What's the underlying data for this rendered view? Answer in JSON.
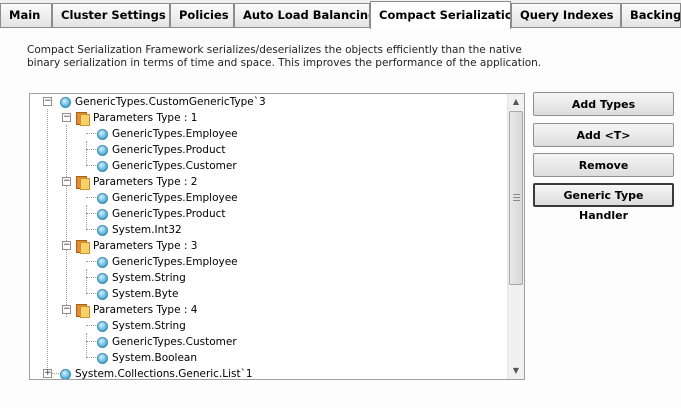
{
  "tabs": [
    {
      "label": "Main"
    },
    {
      "label": "Cluster Settings"
    },
    {
      "label": "Policies"
    },
    {
      "label": "Auto Load Balancing"
    },
    {
      "label": "Compact Serialization",
      "active": true
    },
    {
      "label": "Query Indexes"
    },
    {
      "label": "Backing"
    }
  ],
  "description": {
    "line1": "Compact Serialization Framework serializes/deserializes the objects efficiently than the native",
    "line2": "binary serialization in terms of time and space. This improves the performance of the application."
  },
  "tree": {
    "root1": "GenericTypes.CustomGenericType`3",
    "groups": [
      {
        "label": "Parameters Type : 1",
        "items": [
          "GenericTypes.Employee",
          "GenericTypes.Product",
          "GenericTypes.Customer"
        ]
      },
      {
        "label": "Parameters Type : 2",
        "items": [
          "GenericTypes.Employee",
          "GenericTypes.Product",
          "System.Int32"
        ]
      },
      {
        "label": "Parameters Type : 3",
        "items": [
          "GenericTypes.Employee",
          "System.String",
          "System.Byte"
        ]
      },
      {
        "label": "Parameters Type : 4",
        "items": [
          "System.String",
          "GenericTypes.Customer",
          "System.Boolean"
        ]
      }
    ],
    "root2": "System.Collections.Generic.List`1",
    "icons": {
      "type": "generic-type-icon",
      "group": "folder-icon"
    }
  },
  "buttons": {
    "add_types": "Add Types",
    "add_t": "Add <T>",
    "remove": "Remove",
    "generic_handler": "Generic Type Handler"
  },
  "scrollbar": {
    "up": "▲",
    "down": "▼"
  }
}
